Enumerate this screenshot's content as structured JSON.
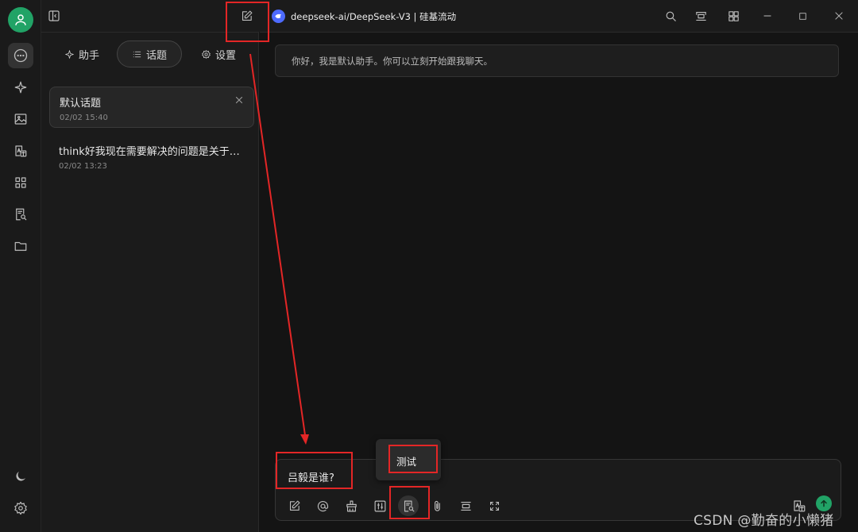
{
  "titlebar": {
    "model_label": "deepseek-ai/DeepSeek-V3 | 硅基流动"
  },
  "sidebar": {
    "tabs": [
      {
        "label": "助手",
        "icon": "sparkle-icon",
        "active": false
      },
      {
        "label": "话题",
        "icon": "list-icon",
        "active": true
      },
      {
        "label": "设置",
        "icon": "gear-icon",
        "active": false
      }
    ],
    "topics": [
      {
        "title": "默认话题",
        "time": "02/02 15:40",
        "active": true
      },
      {
        "title": "think好我现在需要解决的问题是关于…",
        "time": "02/02 13:23",
        "active": false
      }
    ]
  },
  "chat": {
    "welcome": "你好，我是默认助手。你可以立刻开始跟我聊天。",
    "input_value": "吕毅是谁?",
    "tooltip": "测试"
  },
  "colors": {
    "accent": "#21a366",
    "annotation": "#e32626",
    "model_logo": "#4d6bfe"
  },
  "watermark": "CSDN @勤奋的小懒猪"
}
